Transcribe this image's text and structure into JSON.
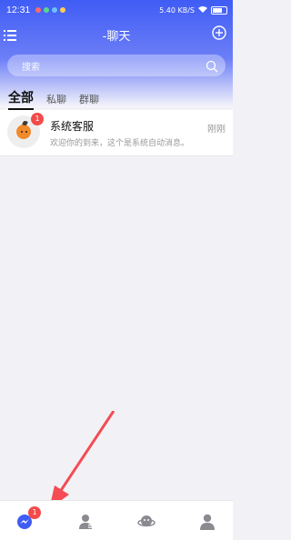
{
  "status_bar": {
    "time": "12:31",
    "network_text": "5.40 KB/S"
  },
  "header": {
    "title": "-聊天"
  },
  "search": {
    "placeholder": "搜索"
  },
  "tabs": [
    {
      "label": "全部",
      "active": true
    },
    {
      "label": "私聊",
      "active": false
    },
    {
      "label": "群聊",
      "active": false
    }
  ],
  "conversations": [
    {
      "name": "系统客服",
      "message": "欢迎你的到来，这个是系统自动消息。",
      "time": "刚刚",
      "unread": "1"
    }
  ],
  "bottom_nav": {
    "chat_badge": "1"
  },
  "colors": {
    "primary": "#3f5cf5",
    "badge": "#f24b4b"
  }
}
